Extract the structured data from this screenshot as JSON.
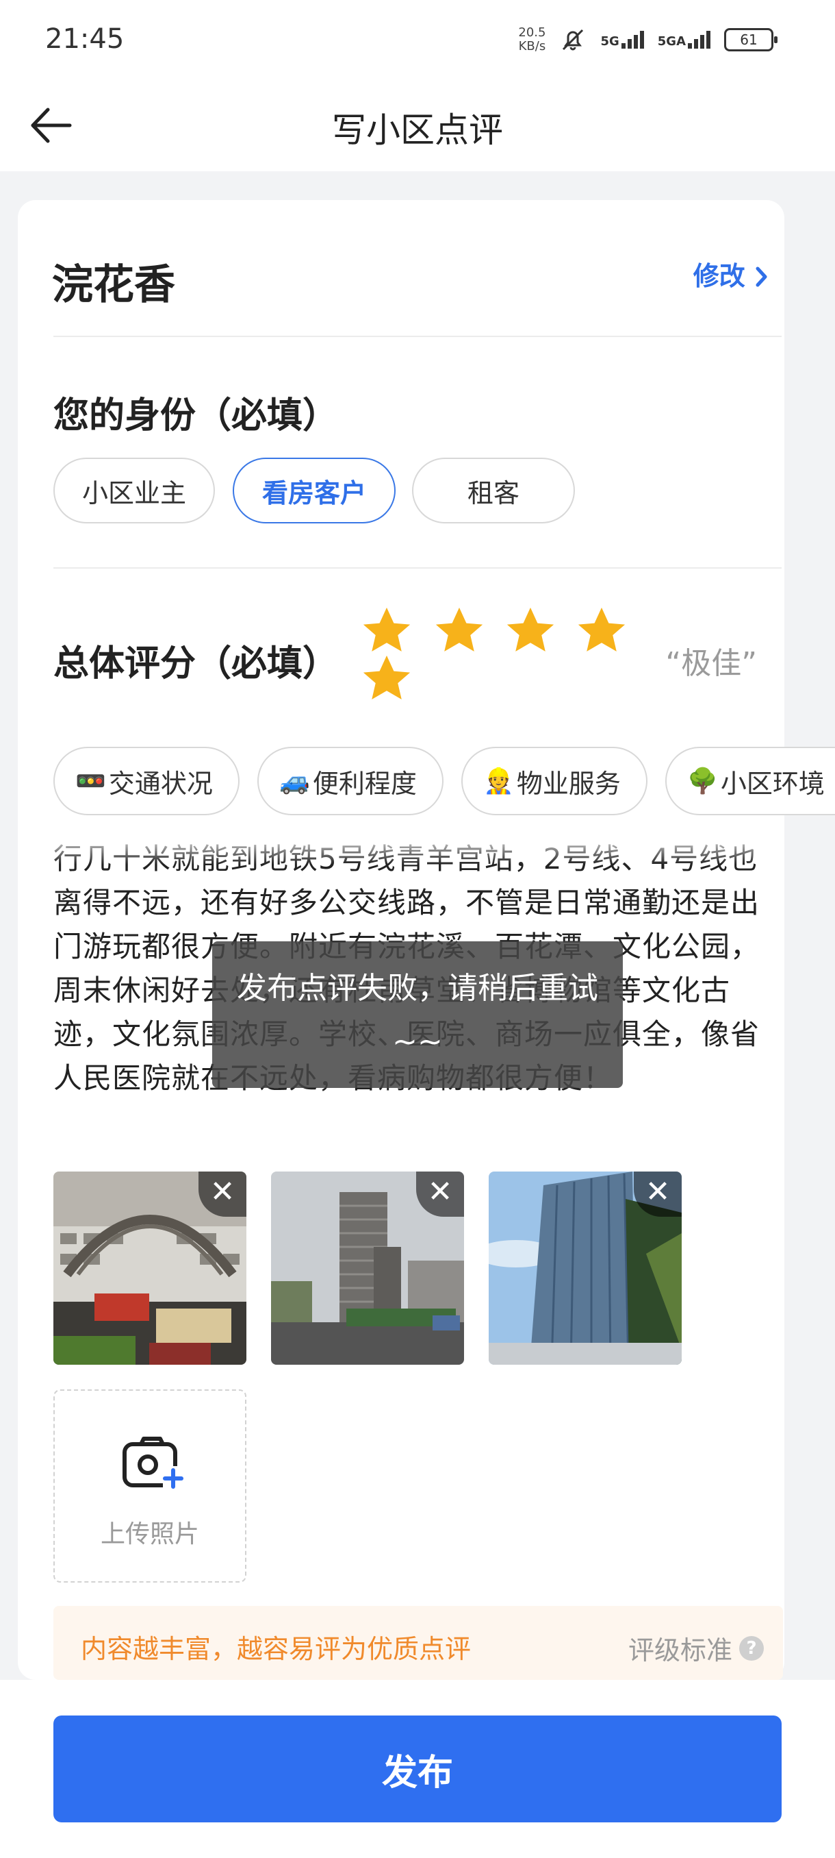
{
  "status_bar": {
    "time": "21:45",
    "speed_value": "20.5",
    "speed_unit": "KB/s",
    "net1": "5G",
    "net2": "5GA",
    "battery": "61"
  },
  "nav": {
    "title": "写小区点评",
    "back_icon": "arrow-left-icon"
  },
  "community": {
    "name": "浣花香",
    "modify_label": "修改",
    "modify_icon": "chevron-right-icon"
  },
  "identity": {
    "title": "您的身份（必填）",
    "options": [
      "小区业主",
      "看房客户",
      "租客"
    ],
    "selected": "看房客户"
  },
  "rating": {
    "title": "总体评分（必填）",
    "stars": 5,
    "max": 5,
    "label": "“极佳”",
    "star_color": "#f7b21a"
  },
  "tags": [
    {
      "emoji": "🚥",
      "label": "交通状况"
    },
    {
      "emoji": "🚙",
      "label": "便利程度"
    },
    {
      "emoji": "👷",
      "label": "物业服务"
    },
    {
      "emoji": "🌳",
      "label": "小区环境"
    }
  ],
  "review": {
    "text": "行几十米就能到地铁5号线青羊宫站，2号线、4号线也离得不远，还有好多公交线路，不管是日常通勤还是出门游玩都很方便。附近有浣花溪、百花潭、文化公园，周末休闲好去处，还有杜甫草堂、省博物馆等文化古迹，文化氛围浓厚。学校、医院、商场一应俱全，像省人民医院就在不远处，看病购物都很方便！"
  },
  "photos": {
    "count": 3,
    "close_icon": "close-icon"
  },
  "upload": {
    "label": "上传照片",
    "icon": "camera-plus-icon"
  },
  "tip": {
    "text": "内容越丰富，越容易评为优质点评",
    "link": "评级标准",
    "help_icon": "question-icon"
  },
  "toast": {
    "text": "发布点评失败，请稍后重试~~"
  },
  "publish_button": "发布",
  "colors": {
    "accent": "#2f6ff0",
    "tip_text": "#f08a2c",
    "tip_bg": "#fef6ee"
  }
}
